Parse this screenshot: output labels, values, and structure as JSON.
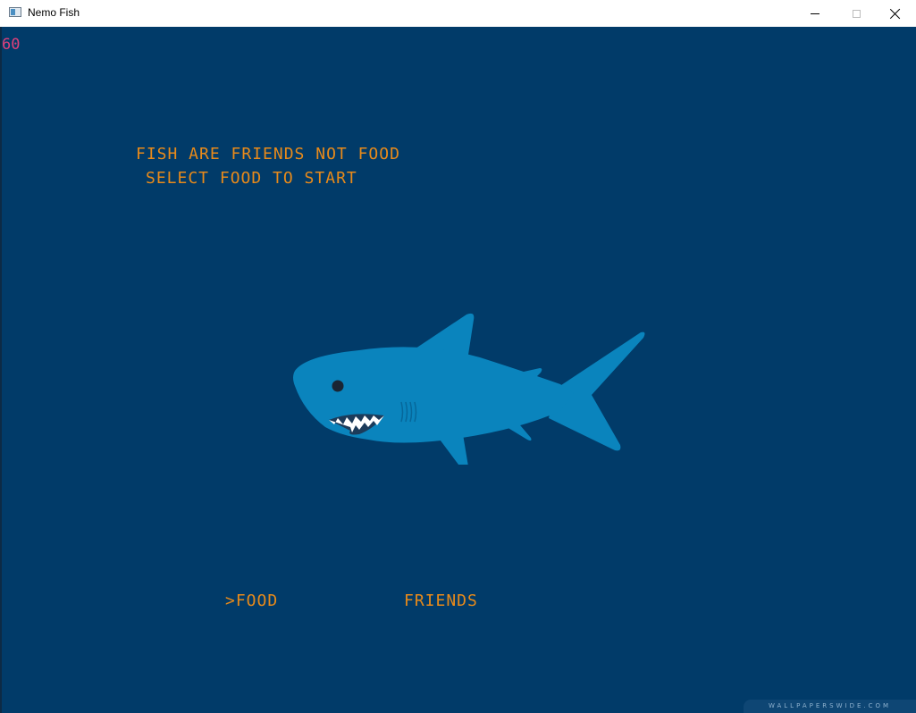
{
  "window": {
    "title": "Nemo Fish",
    "icon": "app-window-icon"
  },
  "controls": {
    "minimize_icon": "minimize-icon",
    "maximize_icon": "maximize-icon",
    "close_icon": "close-icon"
  },
  "game": {
    "fps": "60",
    "message_line1": "FISH ARE FRIENDS NOT FOOD",
    "message_line2": "SELECT FOOD TO START",
    "menu": {
      "food": ">FOOD",
      "friends": "FRIENDS"
    },
    "selected": "FOOD",
    "watermark": "WALLPAPERSWIDE.COM"
  },
  "colors": {
    "background": "#013b69",
    "text": "#e88a1a",
    "fps": "#e0407a",
    "shark": "#0a84bd",
    "shark_shade": "#0879b0"
  }
}
